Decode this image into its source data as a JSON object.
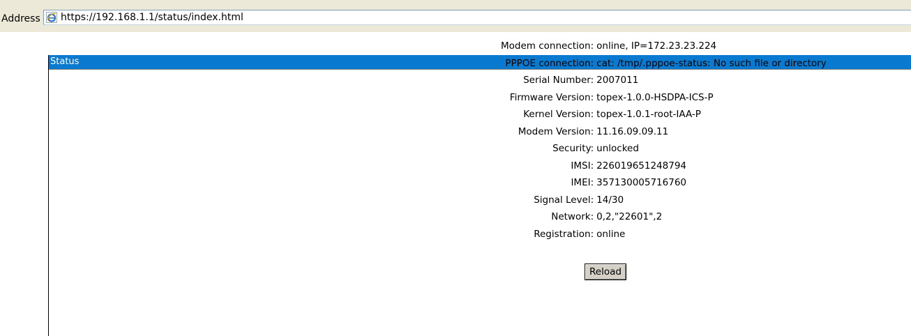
{
  "address_bar": {
    "label": "Address",
    "url": "https://192.168.1.1/status/index.html",
    "icon": "internet-explorer-icon"
  },
  "panel": {
    "title": "Status"
  },
  "status_rows": [
    {
      "label": "Modem connection:",
      "value": "online, IP=172.23.23.224"
    },
    {
      "label": "PPPOE connection:",
      "value": "cat: /tmp/.pppoe-status: No such file or directory"
    },
    {
      "label": "Serial Number:",
      "value": "2007011"
    },
    {
      "label": "Firmware Version:",
      "value": "topex-1.0.0-HSDPA-ICS-P"
    },
    {
      "label": "Kernel Version:",
      "value": "topex-1.0.1-root-IAA-P"
    },
    {
      "label": "Modem Version:",
      "value": "11.16.09.09.11"
    },
    {
      "label": "Security:",
      "value": "unlocked"
    },
    {
      "label": "IMSI:",
      "value": "226019651248794"
    },
    {
      "label": "IMEI:",
      "value": "357130005716760"
    },
    {
      "label": "Signal Level:",
      "value": "14/30"
    },
    {
      "label": "Network:",
      "value": "0,2,\"22601\",2"
    },
    {
      "label": "Registration:",
      "value": "online"
    }
  ],
  "actions": {
    "reload_label": "Reload"
  },
  "colors": {
    "header_bg": "#0a7ad0",
    "header_text": "#ffffff",
    "toolbar_bg": "#ece9d8"
  }
}
